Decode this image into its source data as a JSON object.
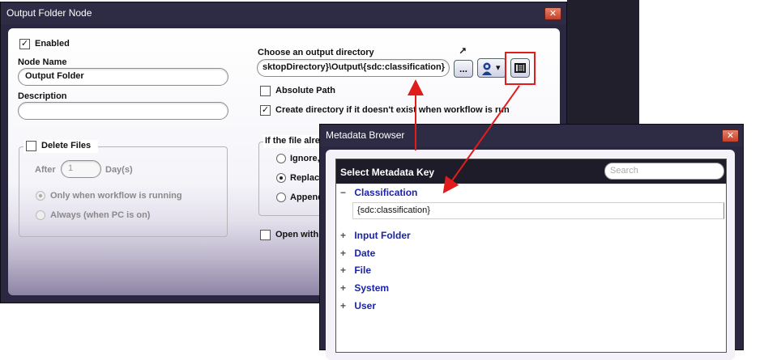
{
  "output_window": {
    "title": "Output Folder Node",
    "close_glyph": "✕",
    "enabled_label": "Enabled",
    "enabled_checked": true,
    "node_name_label": "Node Name",
    "node_name_value": "Output Folder",
    "description_label": "Description",
    "description_value": "",
    "delete_files_label": "Delete Files",
    "delete_files_checked": false,
    "after_label": "After",
    "after_value": "1",
    "days_label": "Day(s)",
    "only_running_label": "Only when workflow is running",
    "always_label": "Always (when PC is on)",
    "choose_dir_label": "Choose an output directory",
    "dir_value": "sktopDirectory}\\Output\\{sdc:classification}",
    "browse_label": "...",
    "absolute_path_label": "Absolute Path",
    "absolute_path_checked": false,
    "create_dir_label": "Create directory if it doesn't exist when workflow is run",
    "create_dir_checked": true,
    "if_file_label": "If the file alre",
    "ignore_label": "Ignore,",
    "replace_label": "Replace",
    "append_label": "Append",
    "open_with_label": "Open with",
    "open_with_checked": false
  },
  "icons": {
    "checkmark": "✓",
    "pointer": "↗",
    "dropdown": "▾"
  },
  "metadata_browser": {
    "title": "Metadata Browser",
    "close_glyph": "✕",
    "header": "Select Metadata Key",
    "search_placeholder": "Search",
    "expanded_sign": "−",
    "collapsed_sign": "+",
    "tree": [
      {
        "label": "Classification",
        "expanded": true,
        "children": [
          "{sdc:classification}"
        ]
      },
      {
        "label": "Input Folder",
        "expanded": false
      },
      {
        "label": "Date",
        "expanded": false
      },
      {
        "label": "File",
        "expanded": false
      },
      {
        "label": "System",
        "expanded": false
      },
      {
        "label": "User",
        "expanded": false
      }
    ]
  },
  "colors": {
    "title_bar": "#2e2b45",
    "tree_link": "#1a23a8",
    "annotation_red": "#e01c1c",
    "close_button": "#d0543b"
  }
}
